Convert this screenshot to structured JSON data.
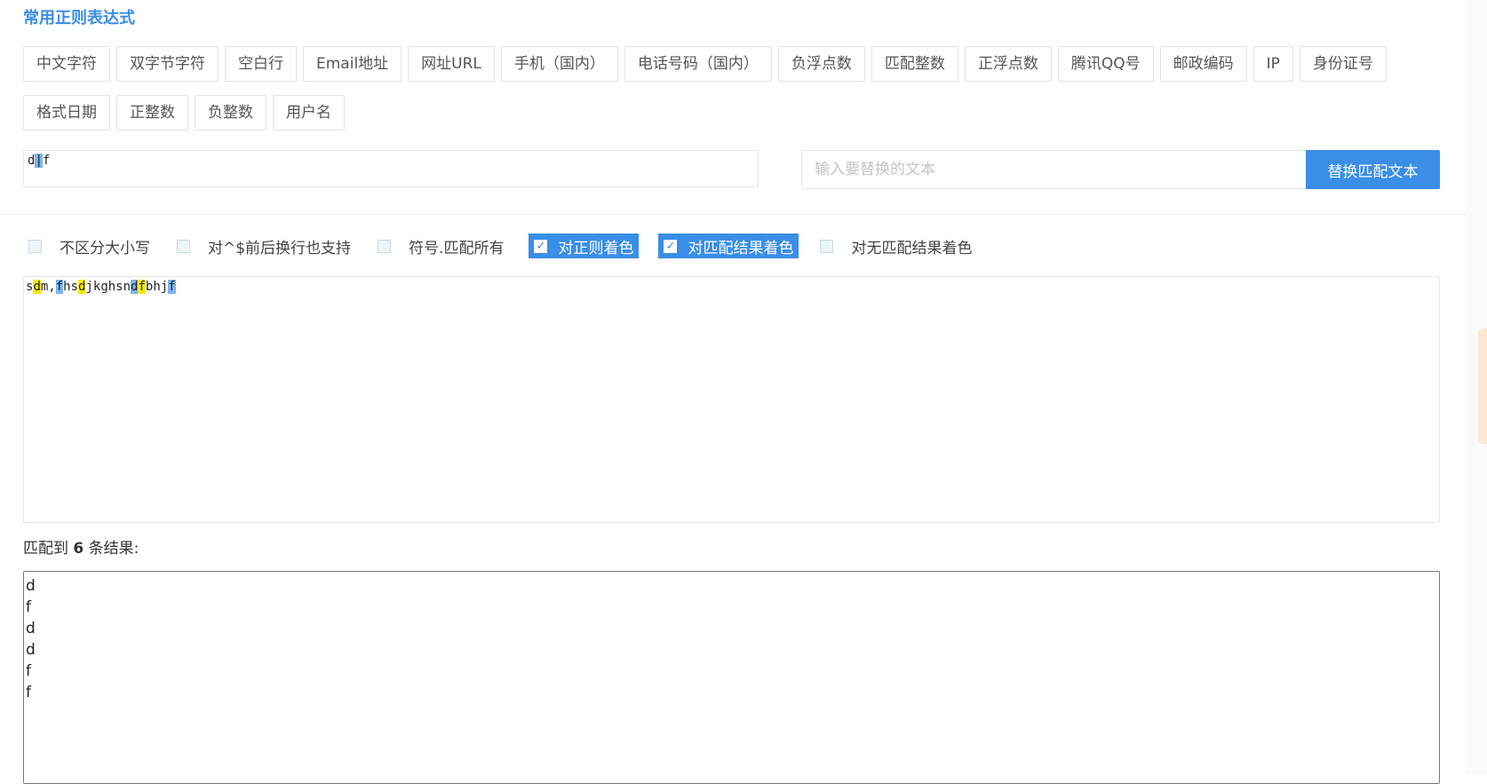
{
  "title": "常用正则表达式",
  "tags_row1": [
    "中文字符",
    "双字节字符",
    "空白行",
    "Email地址",
    "网址URL",
    "手机（国内）",
    "电话号码（国内）",
    "负浮点数",
    "匹配整数",
    "正浮点数",
    "腾讯QQ号",
    "邮政编码",
    "IP",
    "身份证号"
  ],
  "tags_row2": [
    "格式日期",
    "正整数",
    "负整数",
    "用户名"
  ],
  "regex": {
    "part1": "d",
    "part2": "|",
    "part3": "f"
  },
  "replace": {
    "placeholder": "输入要替换的文本",
    "button_label": "替换匹配文本"
  },
  "options": [
    {
      "label": "不区分大小写",
      "checked": false
    },
    {
      "label": "对^$前后换行也支持",
      "checked": false
    },
    {
      "label": "符号.匹配所有",
      "checked": false
    },
    {
      "label": "对正则着色",
      "checked": true
    },
    {
      "label": "对匹配结果着色",
      "checked": true
    },
    {
      "label": "对无匹配结果着色",
      "checked": false
    }
  ],
  "test_text": {
    "segments": [
      {
        "text": "s",
        "hl": ""
      },
      {
        "text": "d",
        "hl": "yellow"
      },
      {
        "text": "m,",
        "hl": ""
      },
      {
        "text": "f",
        "hl": "blue"
      },
      {
        "text": "hs",
        "hl": ""
      },
      {
        "text": "d",
        "hl": "yellow"
      },
      {
        "text": "jkghsn",
        "hl": ""
      },
      {
        "text": "d",
        "hl": "blue"
      },
      {
        "text": "f",
        "hl": "yellow"
      },
      {
        "text": "bhj",
        "hl": ""
      },
      {
        "text": "f",
        "hl": "blue"
      }
    ]
  },
  "result": {
    "prefix": "匹配到",
    "count": "6",
    "suffix": "条结果:"
  },
  "matches": [
    "d",
    "f",
    "d",
    "d",
    "f",
    "f"
  ],
  "colors": {
    "accent": "#3a8ee6",
    "match_yellow": "#f5ea00",
    "match_blue": "#7ab5f0"
  }
}
